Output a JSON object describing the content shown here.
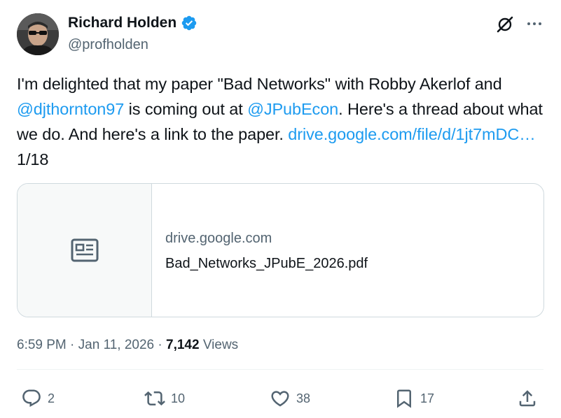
{
  "tweet": {
    "author": {
      "name": "Richard Holden",
      "handle": "@profholden",
      "verified": true,
      "verified_color": "#1d9bf0"
    },
    "text": {
      "seg1": "I'm delighted that my paper \"Bad Networks\" with Robby Akerlof and ",
      "mention1": "@djthornton97",
      "seg2": " is coming out at ",
      "mention2": "@JPubEcon",
      "seg3": ". Here's a thread about what we do. And here's a link to the paper. ",
      "link": "drive.google.com/file/d/1jt7mDC…",
      "seg4": " 1/18"
    },
    "card": {
      "icon": "article-icon",
      "domain": "drive.google.com",
      "title": "Bad_Networks_JPubE_2026.pdf"
    },
    "meta": {
      "time": "6:59 PM",
      "sep1": " · ",
      "date": "Jan 11, 2026",
      "sep2": " · ",
      "views_count": "7,142",
      "views_label": " Views"
    },
    "actions": {
      "replies": "2",
      "retweets": "10",
      "likes": "38",
      "bookmarks": "17"
    }
  },
  "colors": {
    "link": "#1d9bf0",
    "text": "#0f1419",
    "muted": "#536471",
    "border": "#cfd9de"
  }
}
